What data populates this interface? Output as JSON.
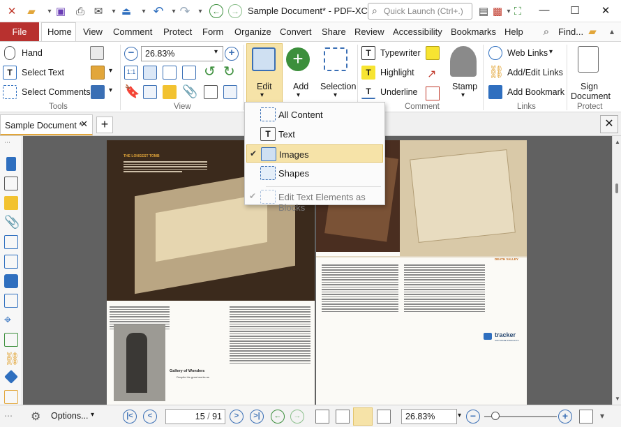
{
  "window": {
    "doc_title": "Sample Document* - PDF-XCh...",
    "quick_launch_placeholder": "Quick Launch (Ctrl+.)"
  },
  "menu_tabs": [
    "File",
    "Home",
    "View",
    "Comment",
    "Protect",
    "Form",
    "Organize",
    "Convert",
    "Share",
    "Review",
    "Accessibility",
    "Bookmarks",
    "Help"
  ],
  "menu_extra": {
    "find": "Find..."
  },
  "ribbon": {
    "tools": {
      "hand": "Hand",
      "select_text": "Select Text",
      "select_comments": "Select Comments",
      "label": "Tools"
    },
    "view": {
      "zoom_value": "26.83%",
      "label": "View"
    },
    "edit": {
      "edit": "Edit",
      "add": "Add",
      "selection": "Selection"
    },
    "comment": {
      "typewriter": "Typewriter",
      "highlight": "Highlight",
      "underline": "Underline",
      "stamp": "Stamp",
      "label": "Comment"
    },
    "links": {
      "web_links": "Web Links",
      "add_edit_links": "Add/Edit Links",
      "add_bookmark": "Add Bookmark",
      "label": "Links"
    },
    "protect": {
      "sign_document_1": "Sign",
      "sign_document_2": "Document",
      "label": "Protect"
    }
  },
  "edit_menu": {
    "items": [
      {
        "label": "All Content",
        "checked": false
      },
      {
        "label": "Text",
        "checked": false
      },
      {
        "label": "Images",
        "checked": true
      },
      {
        "label": "Shapes",
        "checked": false
      }
    ],
    "edit_text_as_blocks": "Edit Text Elements as Blocks"
  },
  "document_tab": {
    "label": "Sample Document *"
  },
  "page_content": {
    "left_heading": "THE LONGEST TOMB",
    "gallery_caption": "Gallery of Wonders",
    "gallery_sub": "Despite his great works as",
    "right_heading": "DEATH VALLEY",
    "tracker_logo": "tracker",
    "tracker_sub": "SOFTWARE PRODUCTS"
  },
  "status": {
    "options": "Options...",
    "page_current": "15",
    "page_total": "91",
    "zoom": "26.83%"
  },
  "colors": {
    "accent": "#b8312f",
    "highlight": "#f6e3a8",
    "blue": "#3a6fb5"
  }
}
